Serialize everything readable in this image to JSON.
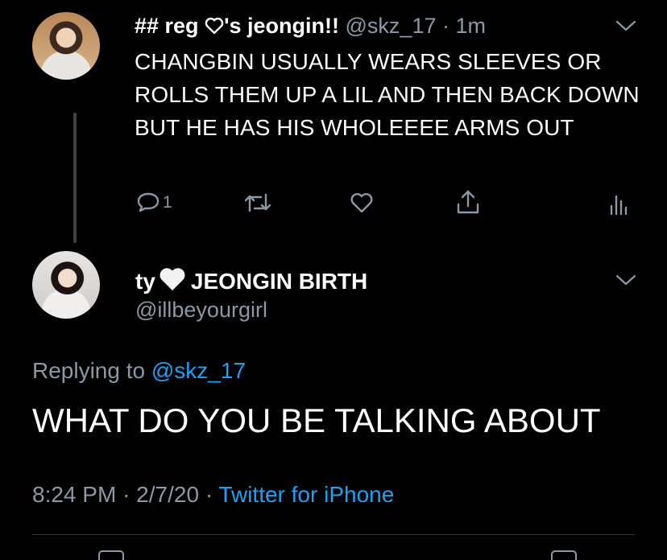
{
  "parent": {
    "name": "## reg",
    "name_suffix": "'s jeongin!!",
    "handle": "@skz_17",
    "separator": "·",
    "time": "1m",
    "text": "CHANGBIN USUALLY WEARS SLEEVES OR ROLLS THEM UP A LIL AND THEN BACK DOWN BUT HE HAS HIS WHOLEEEE ARMS OUT",
    "reply_count": "1"
  },
  "main": {
    "name_prefix": "ty",
    "name_suffix": "JEONGIN BIRTH",
    "handle": "@illbeyourgirl",
    "replying_label": "Replying to",
    "replying_mention": "@skz_17",
    "text": "WHAT DO YOU BE TALKING ABOUT",
    "time": "8:24 PM",
    "separator": "·",
    "date": "2/7/20",
    "source": "Twitter for iPhone"
  },
  "colors": {
    "background": "#000000",
    "secondary_text": "#8b98a5",
    "link": "#1da1f2"
  },
  "icons": [
    "heart-outline-icon",
    "white-heart-icon",
    "chevron-down-icon",
    "reply-icon",
    "retweet-icon",
    "like-icon",
    "share-icon",
    "analytics-icon"
  ]
}
